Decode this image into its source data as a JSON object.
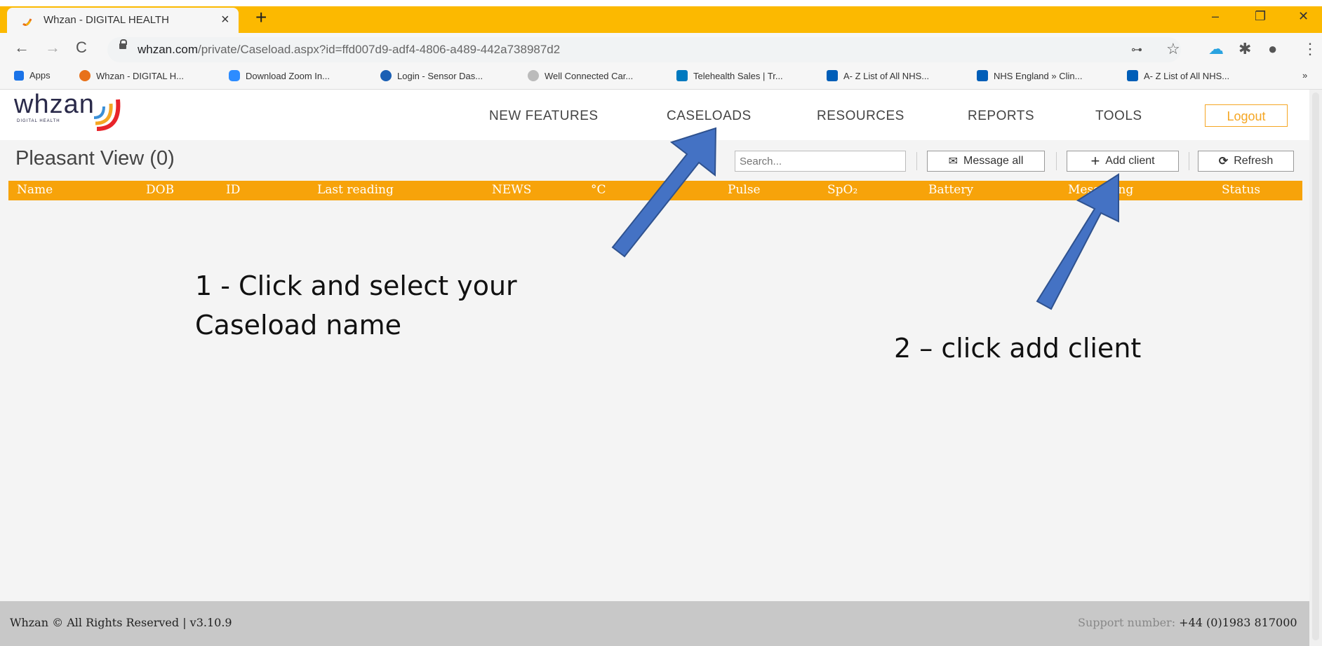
{
  "browser": {
    "tab_title": "Whzan - DIGITAL HEALTH",
    "tab_close": "×",
    "new_tab": "+",
    "url_host": "whzan.com",
    "url_path": "/private/Caseload.aspx?id=ffd007d9-adf4-4806-a489-442a738987d2",
    "window_min": "–",
    "window_restore": "❐",
    "window_close": "✕"
  },
  "bookmarks": [
    {
      "label": "Apps",
      "icon": "apps-grid-icon",
      "color": "#1a73e8"
    },
    {
      "label": "Whzan - DIGITAL H...",
      "icon": "whzan-logo-icon",
      "color": "#e8711a"
    },
    {
      "label": "Download Zoom In...",
      "icon": "zoom-icon",
      "color": "#2d8cff"
    },
    {
      "label": "Login - Sensor Das...",
      "icon": "sensor-icon",
      "color": "#1a5fb4"
    },
    {
      "label": "Well Connected Car...",
      "icon": "globe-icon",
      "color": "#999999"
    },
    {
      "label": "Telehealth Sales | Tr...",
      "icon": "trello-icon",
      "color": "#0079bf"
    },
    {
      "label": "A- Z List of All NHS...",
      "icon": "nhs-icon",
      "color": "#005eb8"
    },
    {
      "label": "NHS England » Clin...",
      "icon": "nhs-icon",
      "color": "#005eb8"
    },
    {
      "label": "A- Z List of All NHS...",
      "icon": "nhs-icon",
      "color": "#005eb8"
    }
  ],
  "app": {
    "logo": "whzan",
    "logo_sub": "DIGITAL HEALTH",
    "nav": [
      "NEW FEATURES",
      "CASELOADS",
      "RESOURCES",
      "REPORTS",
      "TOOLS"
    ],
    "logout": "Logout",
    "accent": "#f7a30a"
  },
  "caseload": {
    "title": "Pleasant View (0)",
    "search_placeholder": "Search...",
    "message_all": "Message all",
    "add_client": "Add client",
    "refresh": "Refresh"
  },
  "columns": [
    "Name",
    "DOB",
    "ID",
    "Last reading",
    "NEWS",
    "°C",
    "Pulse",
    "SpO₂",
    "Battery",
    "Messaging",
    "Status"
  ],
  "annotations": {
    "step1_line1": "1 - Click and select your",
    "step1_line2": "Caseload name",
    "step2": "2 – click add client",
    "arrow_color": "#4472c4"
  },
  "footer": {
    "left": "Whzan © All Rights Reserved | v3.10.9",
    "support_label": "Support number:",
    "support_number": "+44 (0)1983 817000"
  }
}
